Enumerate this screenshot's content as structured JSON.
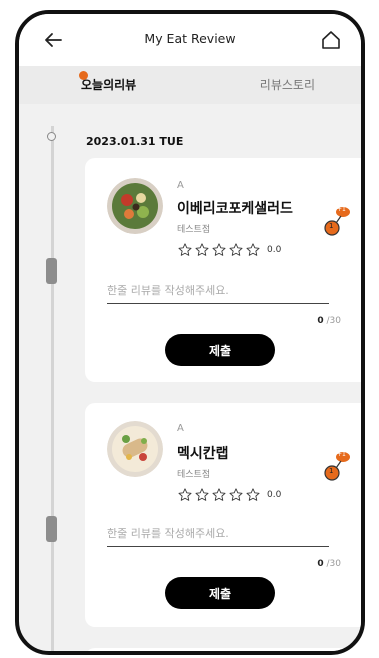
{
  "header": {
    "title": "My Eat Review",
    "back_icon": "arrow-left-icon",
    "home_icon": "home-icon"
  },
  "tabs": [
    {
      "label": "오늘의리뷰",
      "active": true
    },
    {
      "label": "리뷰스토리",
      "active": false
    }
  ],
  "date": "2023.01.31 TUE",
  "accent_color": "#e66a1c",
  "reviews": [
    {
      "letter": "A",
      "name": "이베리코포케샐러드",
      "shop": "테스트점",
      "rating": "0.0",
      "badge_top": "+1",
      "badge_num": "1",
      "placeholder": "한줄 리뷰를 작성해주세요.",
      "count": "0",
      "max": "/30",
      "submit_label": "제출"
    },
    {
      "letter": "A",
      "name": "멕시칸랩",
      "shop": "테스트점",
      "rating": "0.0",
      "badge_top": "+1",
      "badge_num": "1",
      "placeholder": "한줄 리뷰를 작성해주세요.",
      "count": "0",
      "max": "/30",
      "submit_label": "제출"
    }
  ]
}
